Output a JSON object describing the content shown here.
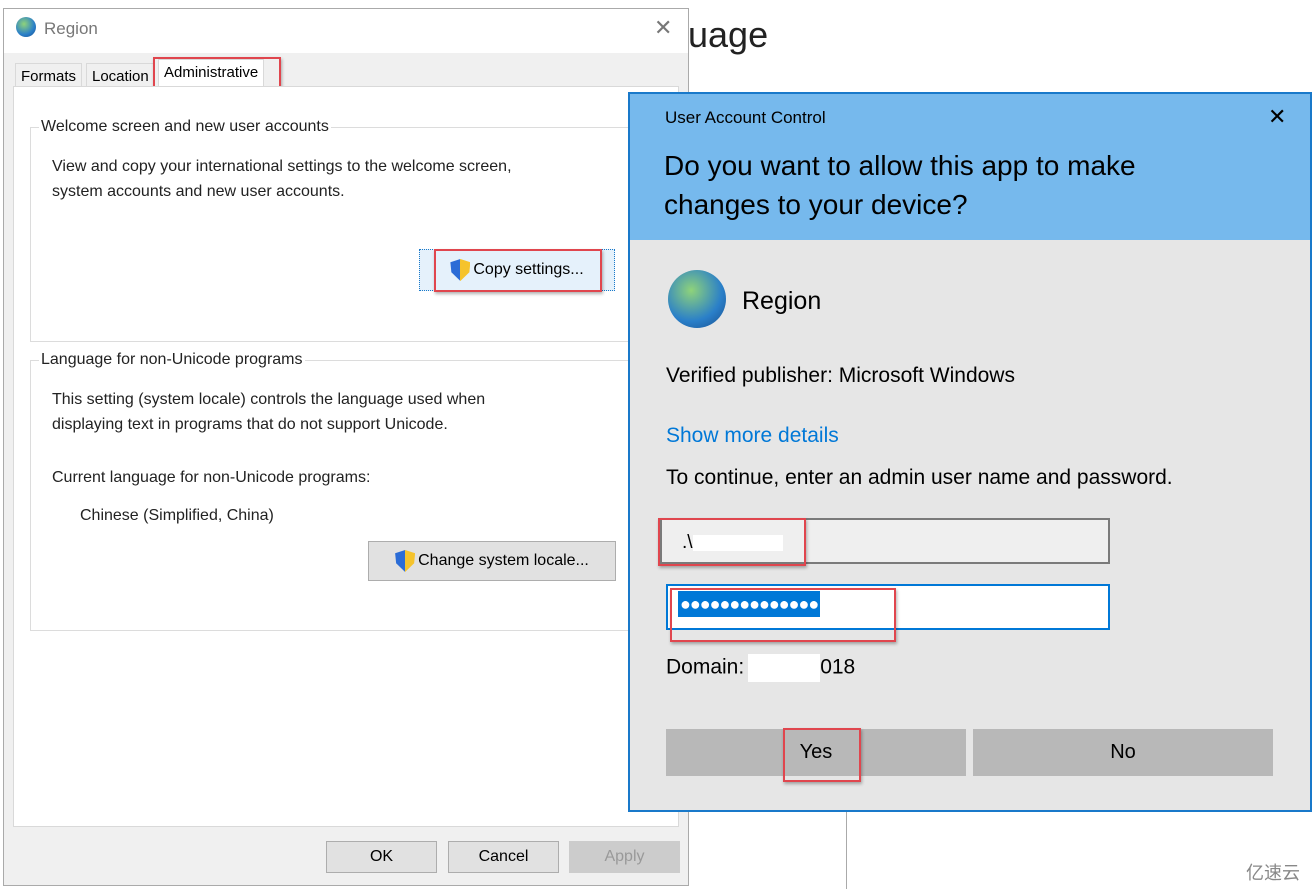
{
  "background": {
    "title_fragment": "uage",
    "watermark": "亿速云"
  },
  "region": {
    "title": "Region",
    "tabs": [
      {
        "label": "Formats"
      },
      {
        "label": "Location"
      },
      {
        "label": "Administrative",
        "active": true
      }
    ],
    "welcome_group": {
      "title": "Welcome screen and new user accounts",
      "line1": "View and copy your international settings to the welcome screen,",
      "line2": "system accounts and new user accounts.",
      "button": "Copy settings..."
    },
    "locale_group": {
      "title": "Language for non-Unicode programs",
      "line1": "This setting (system locale) controls the language used when",
      "line2": "displaying text in programs that do not support Unicode.",
      "current_label": "Current language for non-Unicode programs:",
      "current_value": "Chinese (Simplified, China)",
      "button": "Change system locale..."
    },
    "buttons": {
      "ok": "OK",
      "cancel": "Cancel",
      "apply": "Apply"
    }
  },
  "uac": {
    "title": "User Account Control",
    "question": "Do you want to allow this app to make changes to your device?",
    "app_name": "Region",
    "publisher": "Verified publisher: Microsoft Windows",
    "details_link": "Show more details",
    "instruction": "To continue, enter an admin user name and password.",
    "username_value": ".\\",
    "password_value": "●●●●●●●●●●●●●●",
    "domain_label": "Domain:",
    "domain_value": "018",
    "yes": "Yes",
    "no": "No"
  },
  "colors": {
    "uac_header": "#76b9ed",
    "uac_border": "#1979ca",
    "link": "#0078d7",
    "highlight": "#e0464e",
    "selection": "#0078d7"
  }
}
